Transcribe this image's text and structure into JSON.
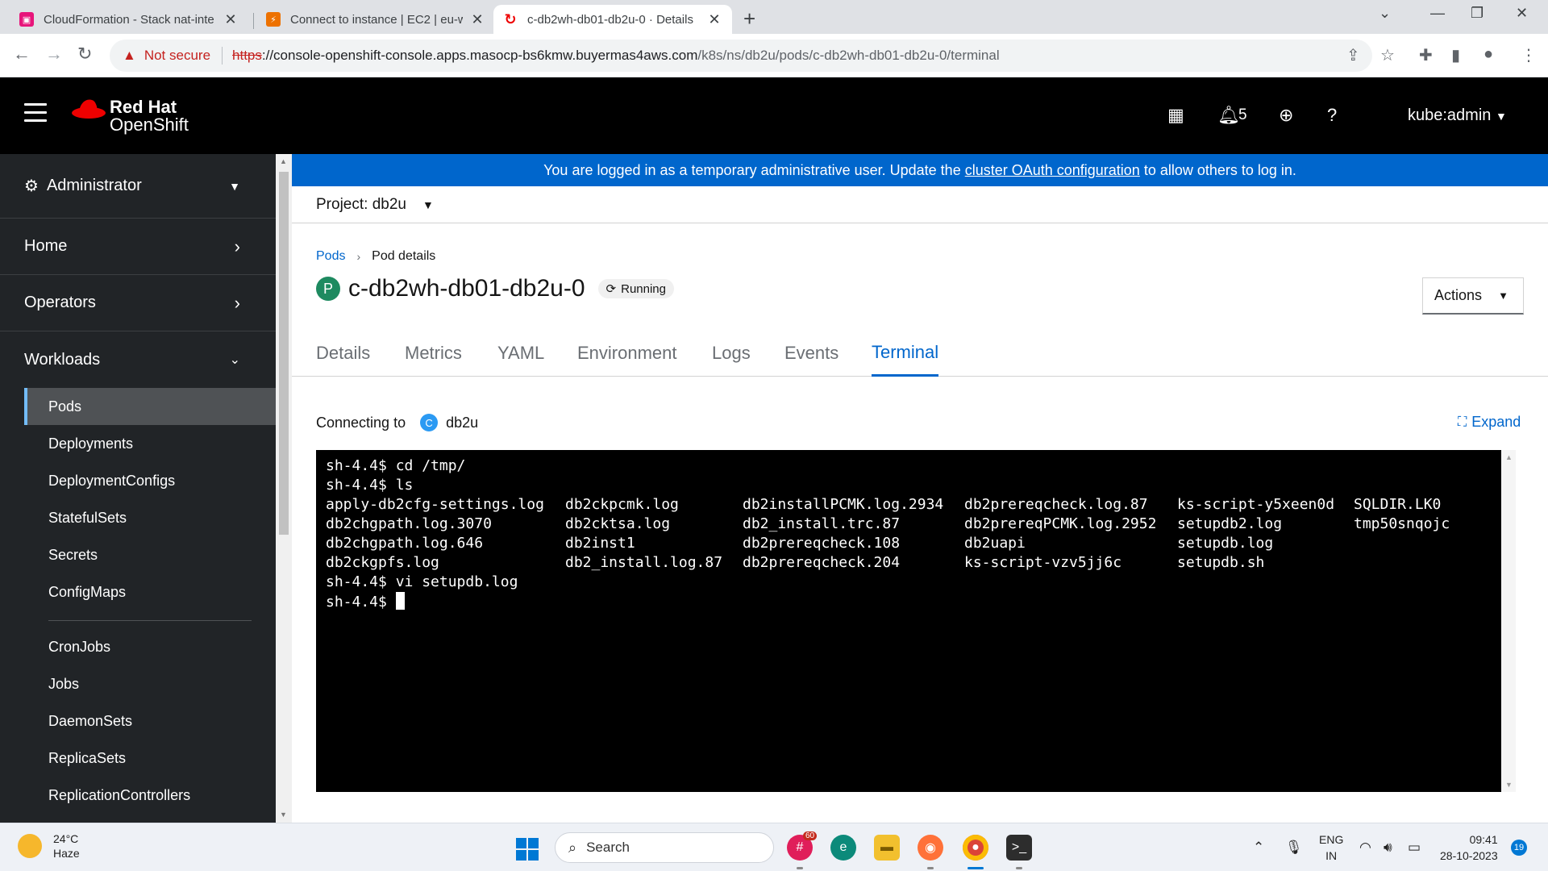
{
  "browser": {
    "tabs": [
      {
        "title": "CloudFormation - Stack nat-inte",
        "color": "#e7157b"
      },
      {
        "title": "Connect to instance | EC2 | eu-w",
        "color": "#ed7100"
      },
      {
        "title": "c-db2wh-db01-db2u-0 · Details",
        "color": "#ee0000"
      }
    ],
    "security_label": "Not secure",
    "url_scheme": "https",
    "url_host": "://console-openshift-console.apps.masocp-bs6kmw.buyermas4aws.com",
    "url_path": "/k8s/ns/db2u/pods/c-db2wh-db01-db2u-0/terminal"
  },
  "masthead": {
    "brand_line1": "Red Hat",
    "brand_line2": "OpenShift",
    "notification_count": "5",
    "user": "kube:admin"
  },
  "sidebar": {
    "perspective": "Administrator",
    "sections": [
      {
        "label": "Home"
      },
      {
        "label": "Operators"
      },
      {
        "label": "Workloads"
      }
    ],
    "workload_items": [
      "Pods",
      "Deployments",
      "DeploymentConfigs",
      "StatefulSets",
      "Secrets",
      "ConfigMaps",
      "CronJobs",
      "Jobs",
      "DaemonSets",
      "ReplicaSets",
      "ReplicationControllers"
    ],
    "active_item": "Pods"
  },
  "banner": {
    "text_before": "You are logged in as a temporary administrative user. Update the",
    "link": "cluster OAuth configuration",
    "text_after": "to allow others to log in."
  },
  "project": {
    "label": "Project: db2u"
  },
  "breadcrumb": {
    "parent": "Pods",
    "current": "Pod details"
  },
  "pod": {
    "badge": "P",
    "name": "c-db2wh-db01-db2u-0",
    "status": "Running",
    "actions_label": "Actions"
  },
  "tabs": [
    "Details",
    "Metrics",
    "YAML",
    "Environment",
    "Logs",
    "Events",
    "Terminal"
  ],
  "active_tab": "Terminal",
  "connecting": {
    "label": "Connecting to",
    "badge": "C",
    "container": "db2u",
    "expand_label": "Expand"
  },
  "terminal": {
    "lines_before": [
      "sh-4.4$ cd /tmp/",
      "sh-4.4$ ls"
    ],
    "ls_rows": [
      [
        "apply-db2cfg-settings.log",
        "db2ckpcmk.log",
        "db2installPCMK.log.2934",
        "db2prereqcheck.log.87",
        "ks-script-y5xeen0d",
        "SQLDIR.LK0"
      ],
      [
        "db2chgpath.log.3070",
        "db2cktsa.log",
        "db2_install.trc.87",
        "db2prereqPCMK.log.2952",
        "setupdb2.log",
        "tmp50snqojc"
      ],
      [
        "db2chgpath.log.646",
        "db2inst1",
        "db2prereqcheck.108",
        "db2uapi",
        "setupdb.log",
        ""
      ],
      [
        "db2ckgpfs.log",
        "db2_install.log.87",
        "db2prereqcheck.204",
        "ks-script-vzv5jj6c",
        "setupdb.sh",
        ""
      ]
    ],
    "lines_after": [
      "sh-4.4$ vi setupdb.log"
    ],
    "prompt": "sh-4.4$ "
  },
  "taskbar": {
    "temperature": "24°C",
    "weather": "Haze",
    "search_placeholder": "Search",
    "slack_badge": "60",
    "lang1": "ENG",
    "lang2": "IN",
    "time": "09:41",
    "date": "28-10-2023",
    "notifications": "19"
  }
}
